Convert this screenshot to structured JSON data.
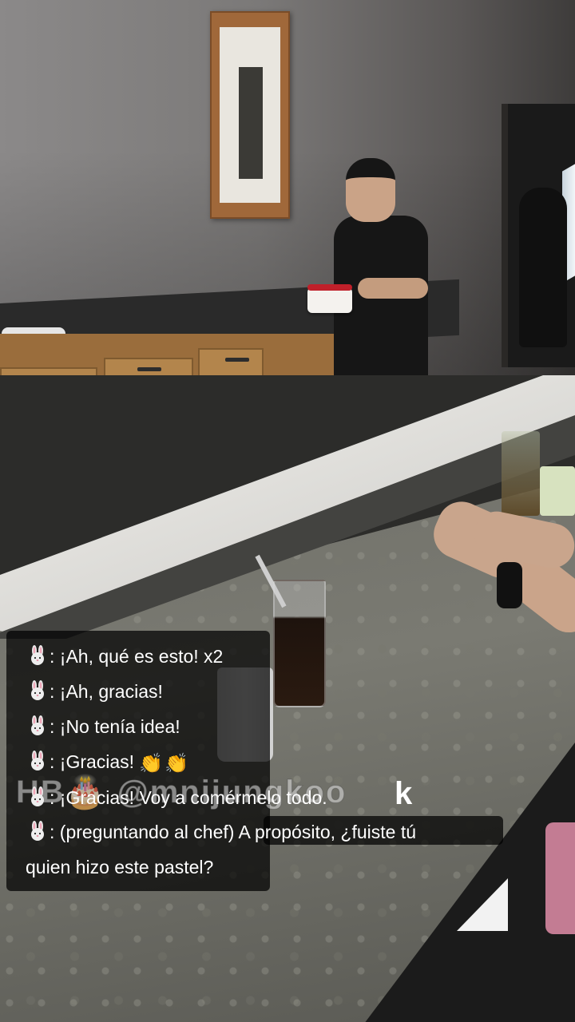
{
  "overlay": {
    "watermark_text": "HB🎂 @mnijungkoo",
    "watermark_suffix": "k"
  },
  "captions": [
    {
      "speaker_icon": "bunny-icon",
      "separator": ":",
      "text": "¡Ah, qué es esto! x2"
    },
    {
      "speaker_icon": "bunny-icon",
      "separator": ":",
      "text": "¡Ah, gracias!"
    },
    {
      "speaker_icon": "bunny-icon",
      "separator": ":",
      "text": "¡No tenía idea!"
    },
    {
      "speaker_icon": "bunny-icon",
      "separator": ":",
      "text": "¡Gracias!",
      "trailing_icons": [
        "clapping-hands-icon",
        "clapping-hands-icon"
      ]
    },
    {
      "speaker_icon": "bunny-icon",
      "separator": ":",
      "text": "¡Gracias! Voy a comérmelo todo."
    },
    {
      "speaker_icon": "bunny-icon",
      "separator": ":",
      "text": "(preguntando al chef) A propósito, ¿fuiste tú"
    },
    {
      "text": "quien hizo este pastel?"
    }
  ],
  "colors": {
    "caption_bg": "#000000",
    "caption_text": "#ffffff",
    "cake_accent": "#c0202a"
  }
}
